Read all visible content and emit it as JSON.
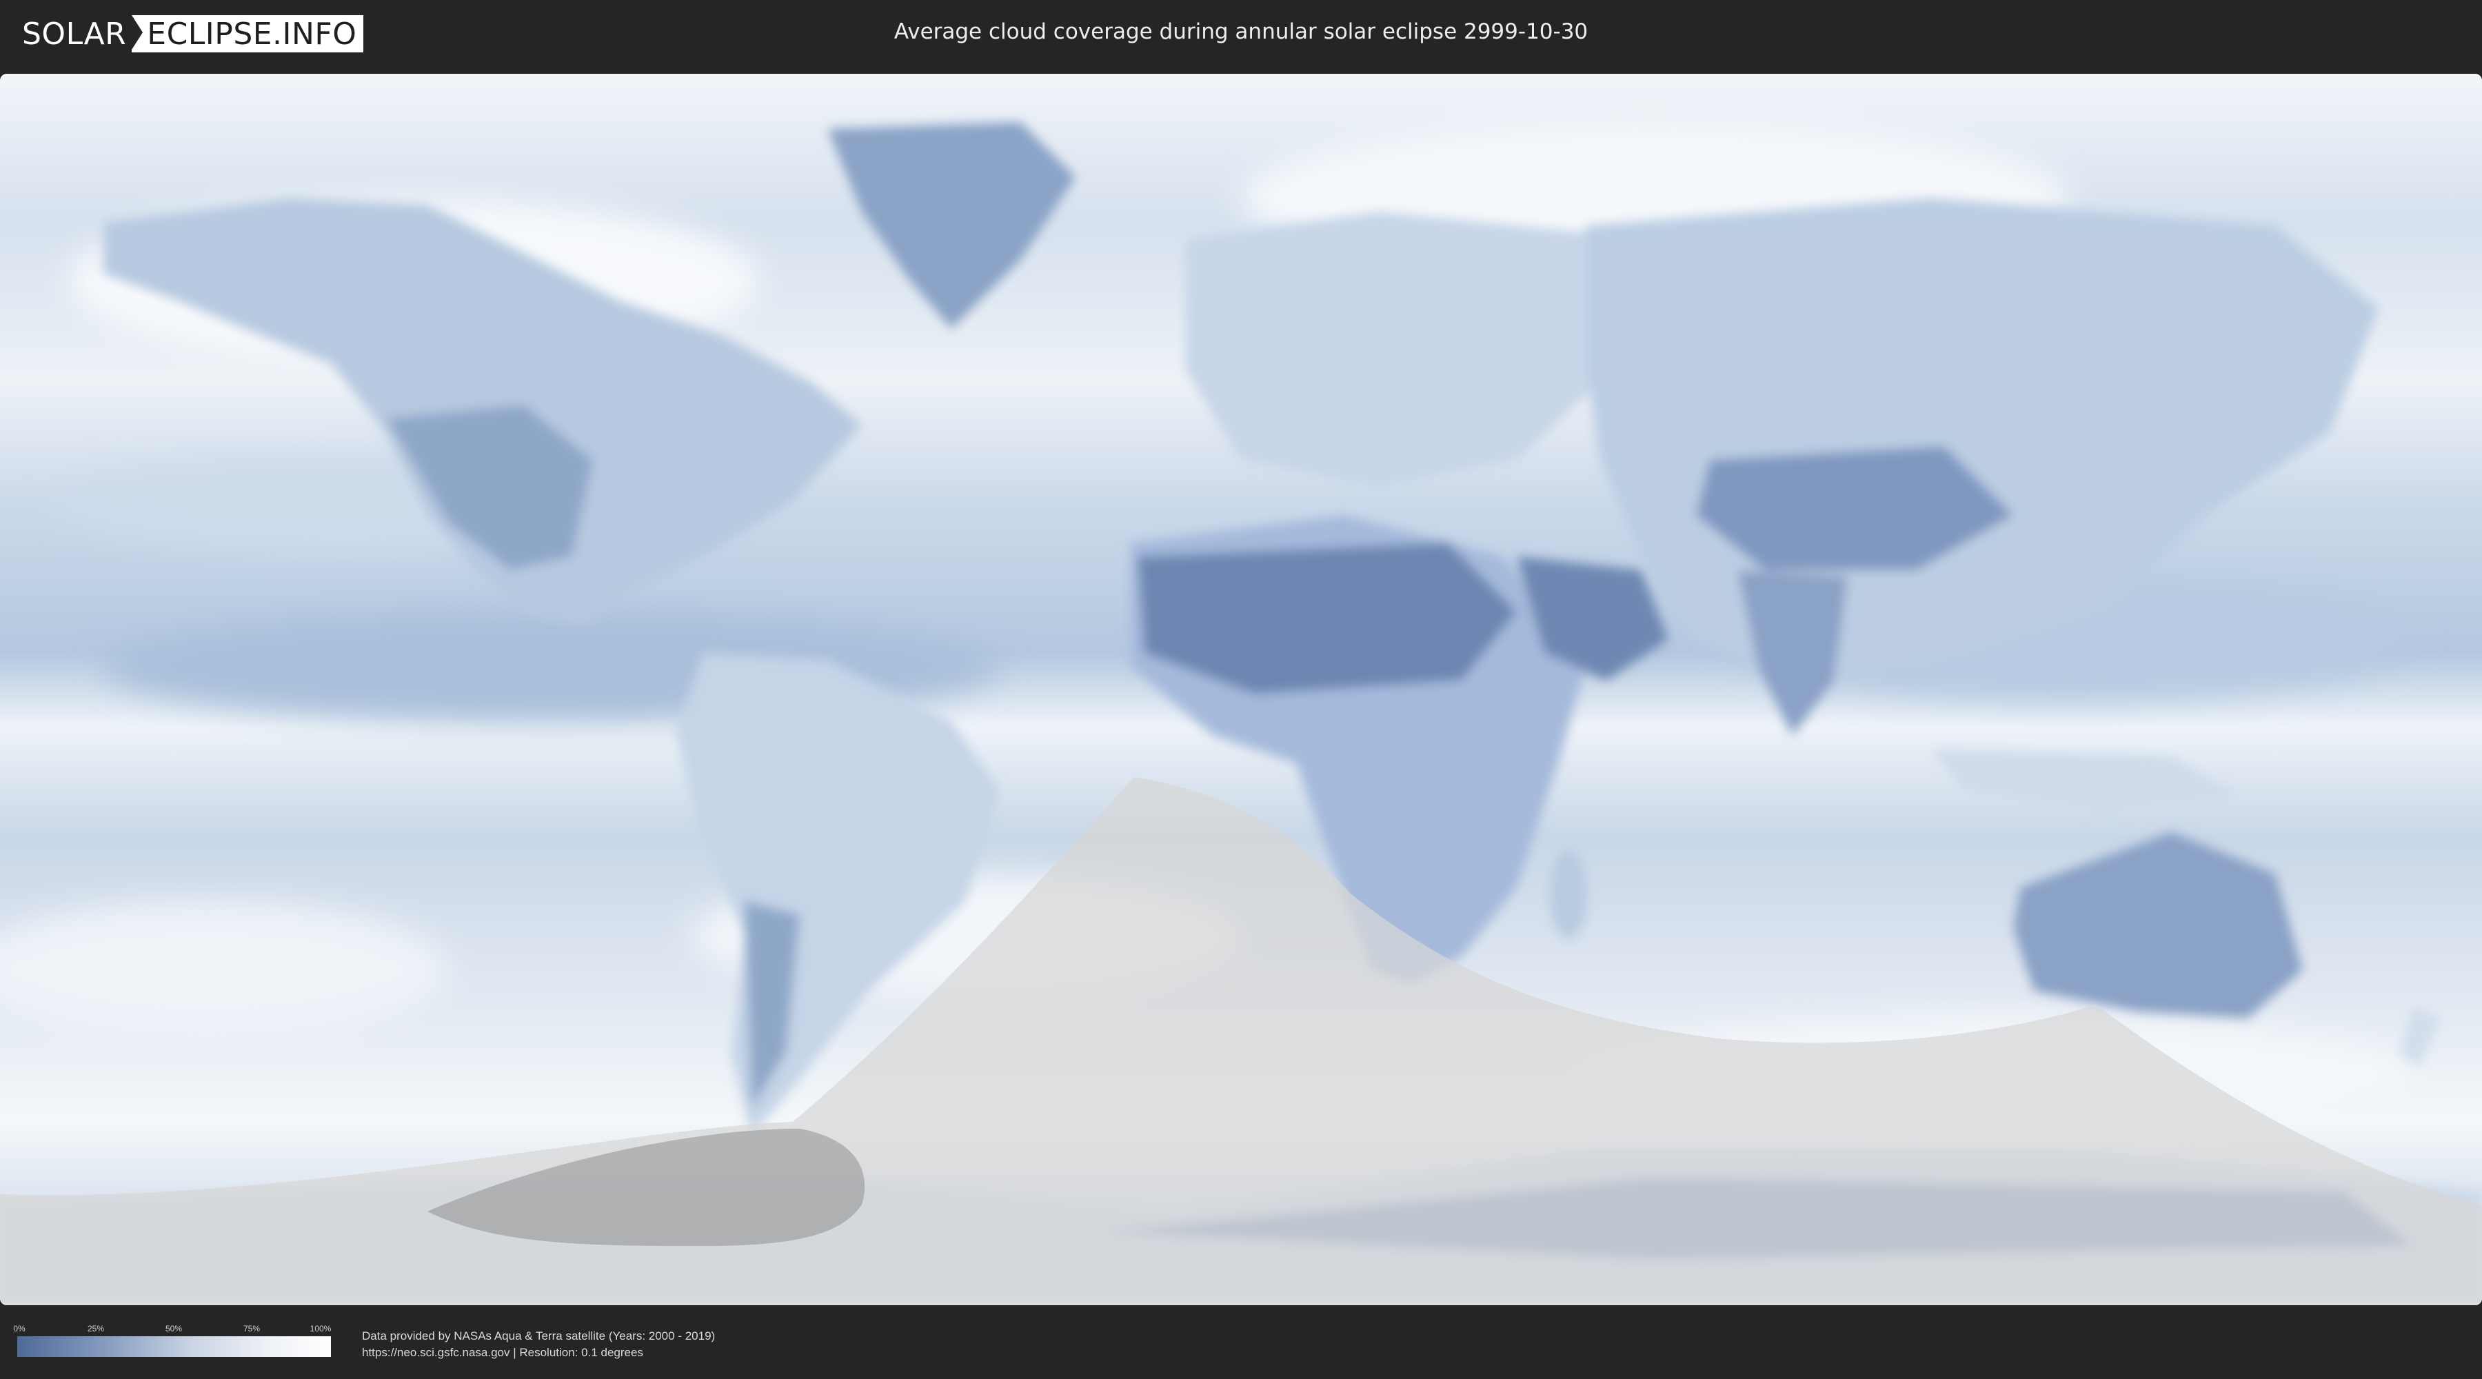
{
  "header": {
    "logo_left": "SOLAR",
    "logo_right": "ECLIPSE.INFO",
    "title": "Average cloud coverage during annular solar eclipse 2999-10-30"
  },
  "legend": {
    "ticks": [
      "0%",
      "25%",
      "50%",
      "75%",
      "100%"
    ],
    "values": [
      0,
      25,
      50,
      75,
      100
    ],
    "colors": [
      "#4f6a98",
      "#8aa0c2",
      "#c9d3e3",
      "#eef1f6",
      "#ffffff"
    ]
  },
  "footer": {
    "credit_line_1": "Data provided by NASAs Aqua & Terra satellite (Years: 2000 - 2019)",
    "credit_line_2": "https://neo.sci.gsfc.nasa.gov | Resolution: 0.1 degrees"
  },
  "map": {
    "projection": "equirectangular",
    "eclipse_type": "annular",
    "ocean_color": "#dde6f0",
    "cloudy_color": "#f5f8fb",
    "clear_color": "#5f7aa6",
    "eclipse_zone_color": "#d6d6d6",
    "annular_path_color": "#9a9a9a"
  }
}
